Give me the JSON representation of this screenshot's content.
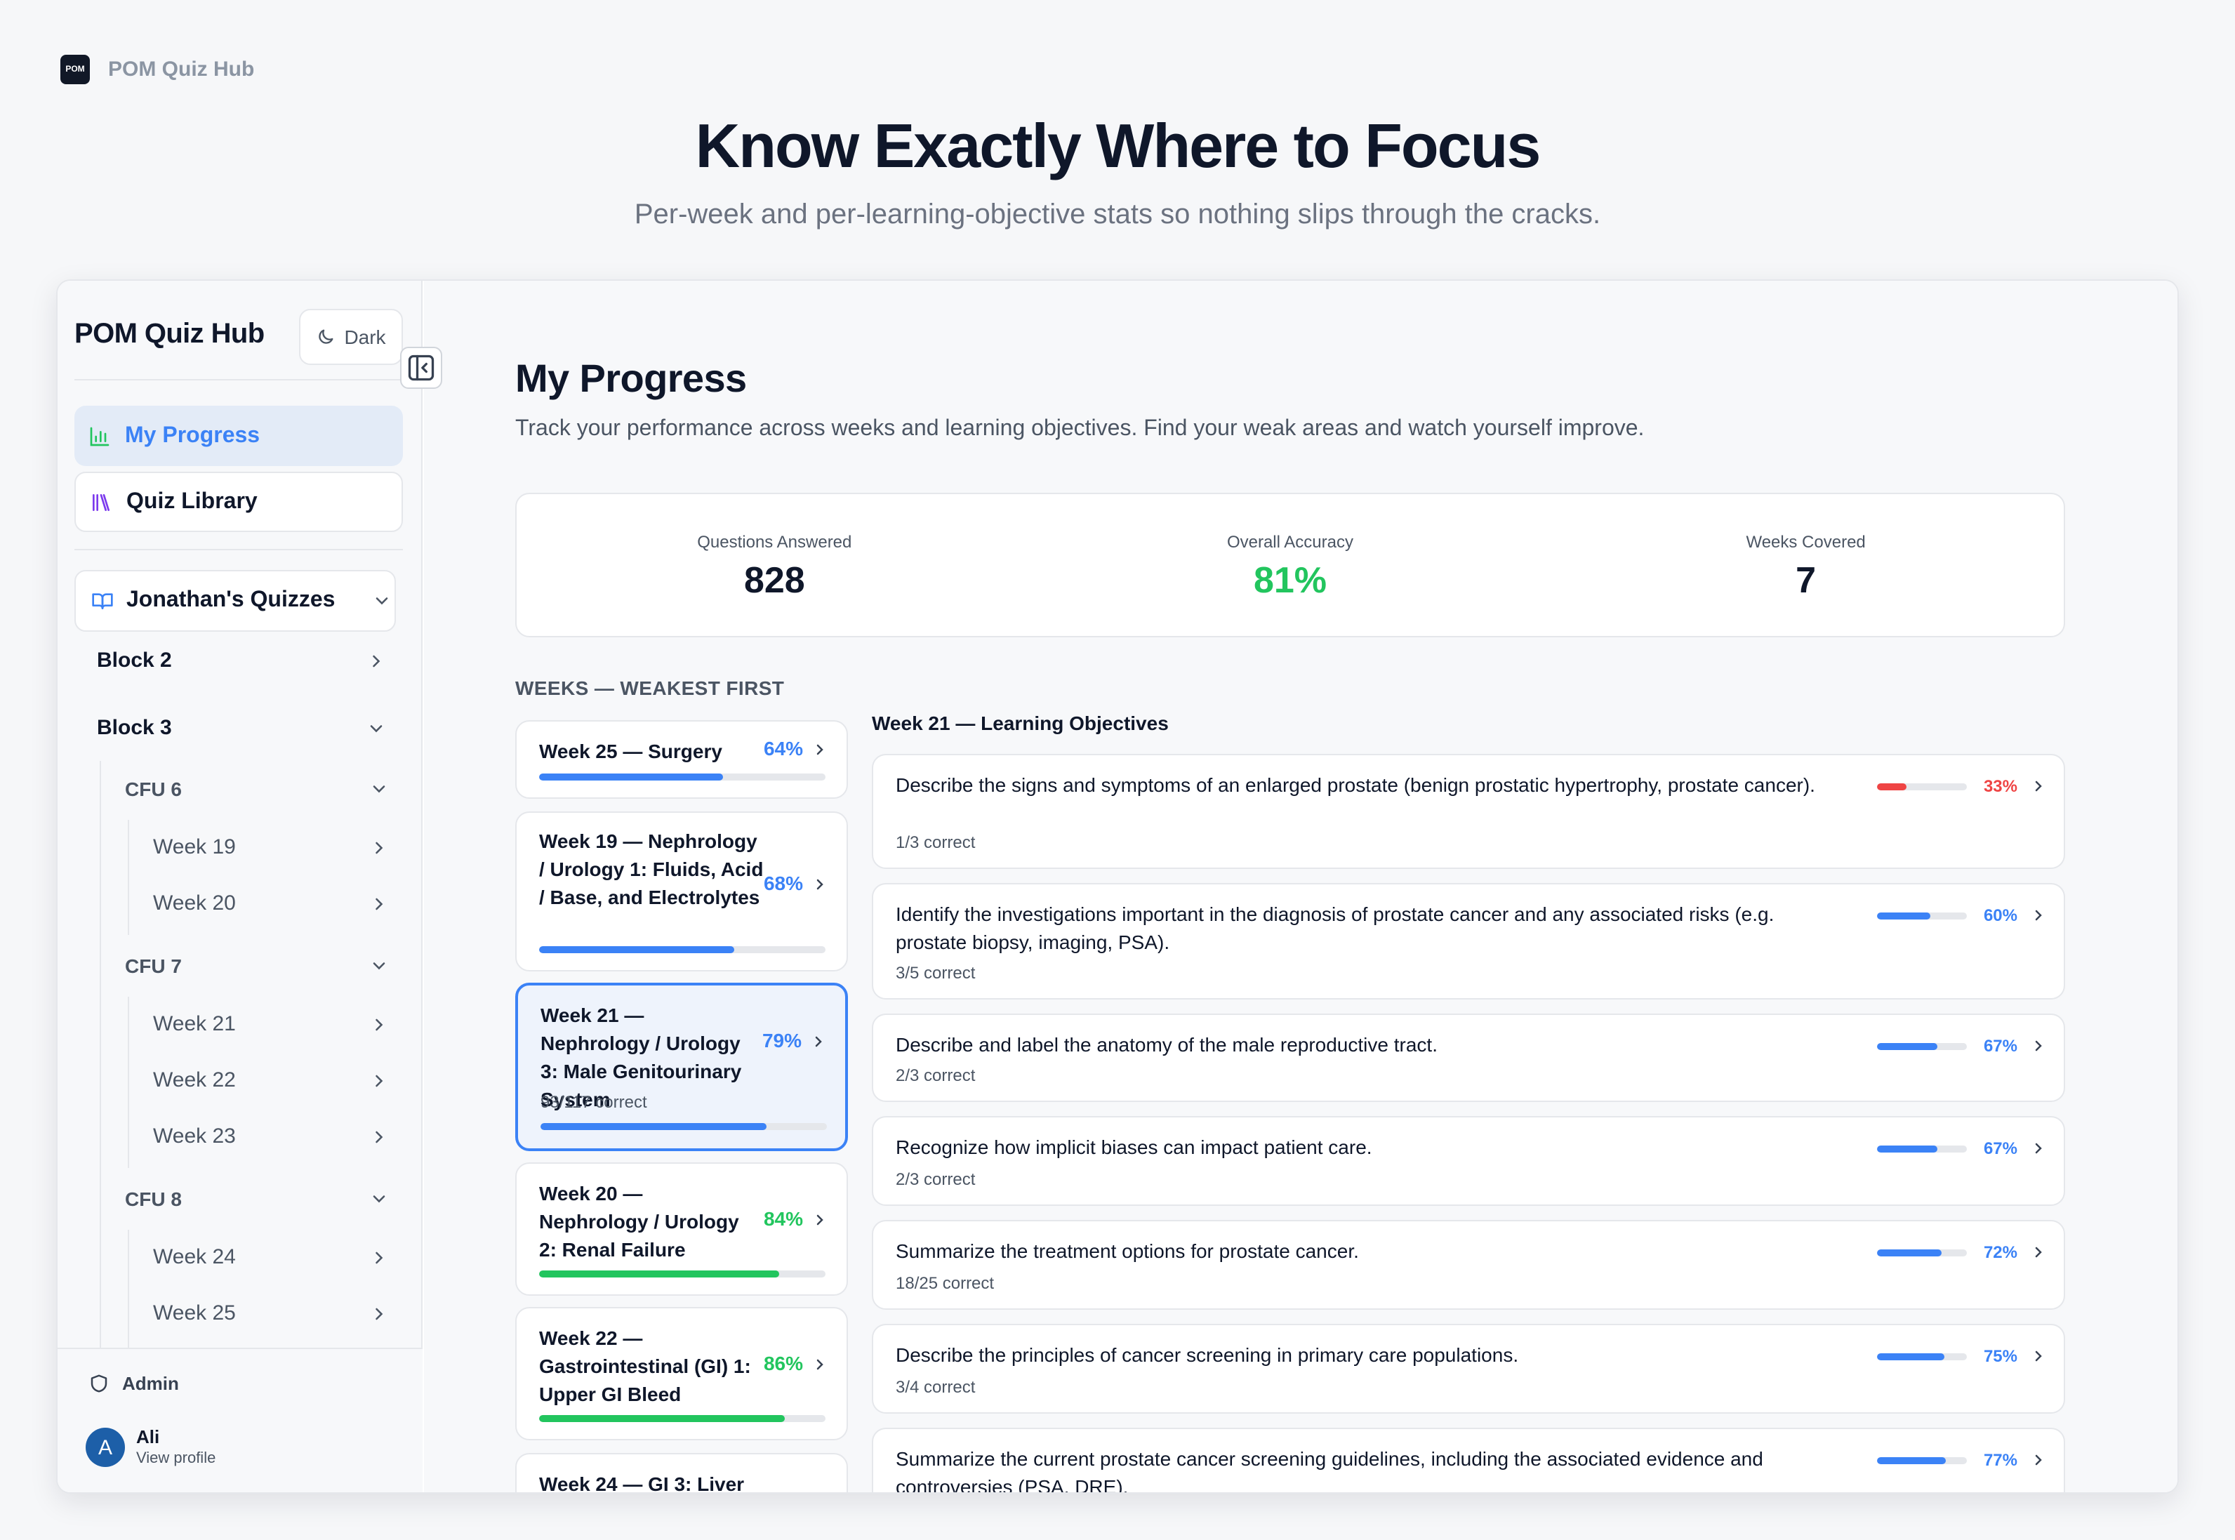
{
  "brand": {
    "logo_text": "POM",
    "name": "POM Quiz Hub"
  },
  "hero": {
    "title": "Know Exactly Where to Focus",
    "subtitle": "Per-week and per-learning-objective stats so nothing slips through the cracks."
  },
  "sidebar": {
    "title": "POM Quiz Hub",
    "dark_label": "Dark",
    "nav": [
      {
        "label": "My Progress"
      },
      {
        "label": "Quiz Library"
      }
    ],
    "quizzes_label": "Jonathan's Quizzes",
    "tree": {
      "block2": "Block 2",
      "block3": "Block 3",
      "cfu6": "CFU 6",
      "cfu6_weeks": [
        "Week 19",
        "Week 20"
      ],
      "cfu7": "CFU 7",
      "cfu7_weeks": [
        "Week 21",
        "Week 22",
        "Week 23"
      ],
      "cfu8": "CFU 8",
      "cfu8_weeks": [
        "Week 24",
        "Week 25"
      ]
    },
    "footer": {
      "admin": "Admin",
      "avatar_initial": "A",
      "user_name": "Ali",
      "user_sub": "View profile"
    }
  },
  "main": {
    "title": "My Progress",
    "description": "Track your performance across weeks and learning objectives. Find your weak areas and watch yourself improve.",
    "stats": [
      {
        "label": "Questions Answered",
        "value": "828"
      },
      {
        "label": "Overall Accuracy",
        "value": "81%"
      },
      {
        "label": "Weeks Covered",
        "value": "7"
      }
    ],
    "weeks_heading": "WEEKS — WEAKEST FIRST",
    "weeks": [
      {
        "title": "Week 25 — Surgery",
        "pct": "64%",
        "fraction": 0.64,
        "color": "#3b82f6"
      },
      {
        "title": "Week 19 — Nephrology / Urology 1: Fluids, Acid / Base, and Electrolytes",
        "pct": "68%",
        "fraction": 0.68,
        "color": "#3b82f6"
      },
      {
        "title": "Week 21 — Nephrology / Urology 3: Male Genitourinary System",
        "pct": "79%",
        "fraction": 0.79,
        "color": "#3b82f6",
        "sub": "93/117 correct"
      },
      {
        "title": "Week 20 — Nephrology / Urology 2: Renal Failure",
        "pct": "84%",
        "fraction": 0.84,
        "color": "#22c55e"
      },
      {
        "title": "Week 22 — Gastrointestinal (GI) 1: Upper GI Bleed",
        "pct": "86%",
        "fraction": 0.86,
        "color": "#22c55e"
      },
      {
        "title": "Week 24 — GI 3: Liver"
      }
    ],
    "lo_heading": "Week 21 — Learning Objectives",
    "objectives": [
      {
        "text": "Describe the signs and symptoms of an enlarged prostate (benign prostatic hypertrophy, prostate cancer).",
        "sub": "1/3 correct",
        "pct": "33%",
        "fraction": 0.33,
        "color": "#ef4444"
      },
      {
        "text": "Identify the investigations important in the diagnosis of prostate cancer and any associated risks (e.g. prostate biopsy, imaging, PSA).",
        "sub": "3/5 correct",
        "pct": "60%",
        "fraction": 0.6,
        "color": "#3b82f6"
      },
      {
        "text": "Describe and label the anatomy of the male reproductive tract.",
        "sub": "2/3 correct",
        "pct": "67%",
        "fraction": 0.67,
        "color": "#3b82f6"
      },
      {
        "text": "Recognize how implicit biases can impact patient care.",
        "sub": "2/3 correct",
        "pct": "67%",
        "fraction": 0.67,
        "color": "#3b82f6"
      },
      {
        "text": "Summarize the treatment options for prostate cancer.",
        "sub": "18/25 correct",
        "pct": "72%",
        "fraction": 0.72,
        "color": "#3b82f6"
      },
      {
        "text": "Describe the principles of cancer screening in primary care populations.",
        "sub": "3/4 correct",
        "pct": "75%",
        "fraction": 0.75,
        "color": "#3b82f6"
      },
      {
        "text": "Summarize the current prostate cancer screening guidelines, including the associated evidence and controversies (PSA, DRE).",
        "pct": "77%",
        "fraction": 0.77,
        "color": "#3b82f6"
      }
    ]
  }
}
